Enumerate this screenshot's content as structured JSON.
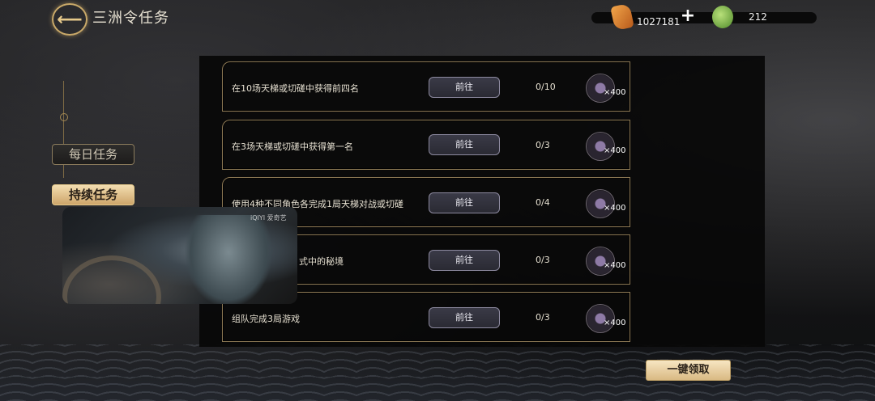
{
  "header": {
    "back_icon": "arrow-left-icon",
    "title": "三洲令任务"
  },
  "currency": {
    "gold": {
      "icon": "gem-orange-icon",
      "value": "1027181"
    },
    "jade": {
      "icon": "jade-green-icon",
      "value": "212"
    }
  },
  "tabs": [
    {
      "label": "每日任务",
      "active": false
    },
    {
      "label": "持续任务",
      "active": true
    }
  ],
  "tasks": [
    {
      "desc": "在10场天梯或切磋中获得前四名",
      "progress": "0/10",
      "reward": "×400",
      "button": "前往"
    },
    {
      "desc": "在3场天梯或切磋中获得第一名",
      "progress": "0/3",
      "reward": "×400",
      "button": "前往"
    },
    {
      "desc": "使用4种不同角色各完成1局天梯对战或切磋",
      "progress": "0/4",
      "reward": "×400",
      "button": "前往"
    },
    {
      "desc": "式中的秘境",
      "progress": "0/3",
      "reward": "×400",
      "button": "前往"
    },
    {
      "desc": "组队完成3局游戏",
      "progress": "0/3",
      "reward": "×400",
      "button": "前往"
    }
  ],
  "video": {
    "watermark": "iQIYI 爱奇艺"
  },
  "claim_all": "一键领取",
  "colors": {
    "gold_border": "#c9a969",
    "panel": "#080808",
    "button": "#3a3a47"
  }
}
